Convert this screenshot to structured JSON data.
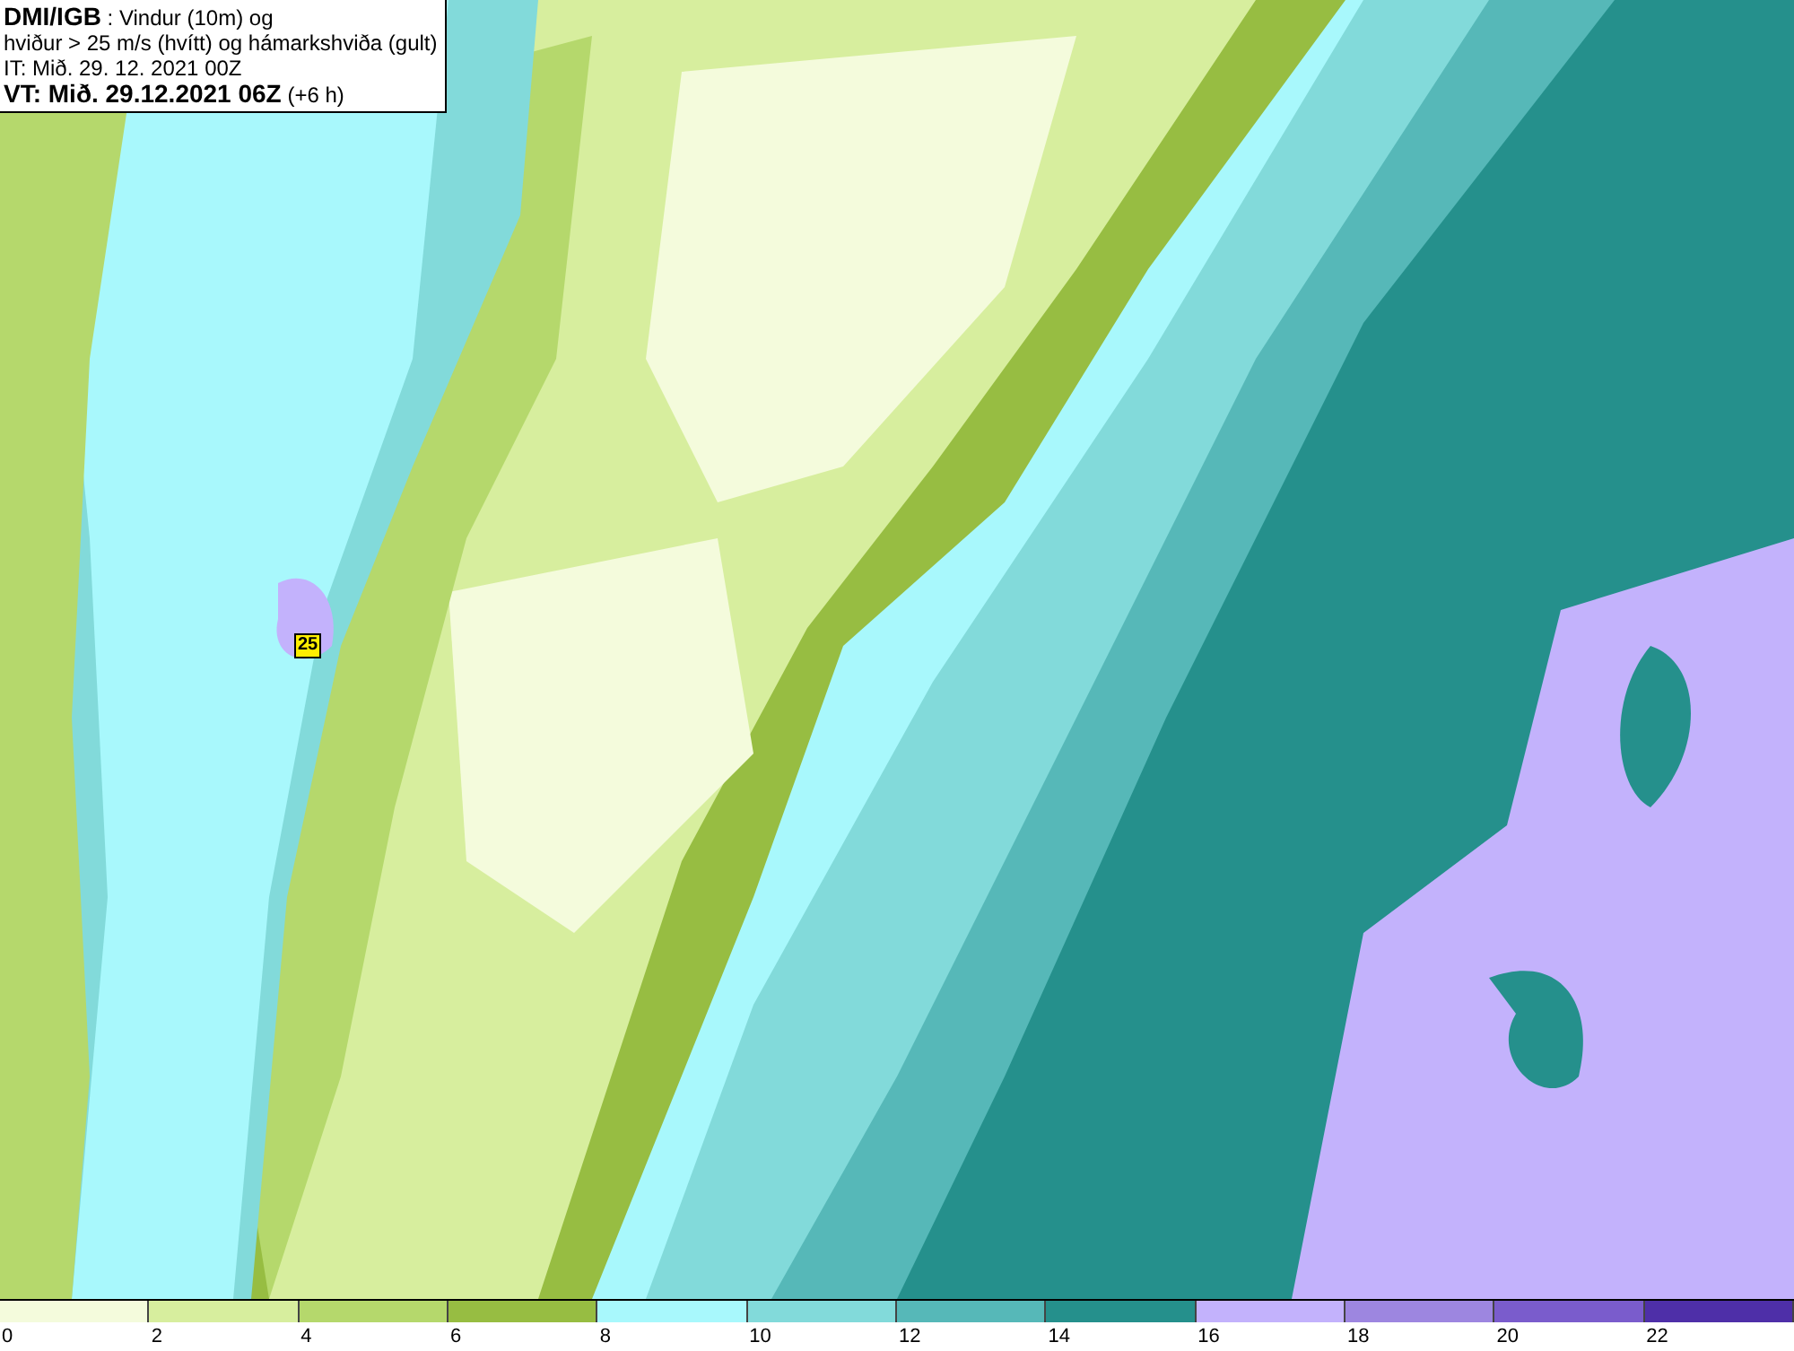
{
  "header": {
    "lines": [
      "**DMI/IGB** : Vindur (10m) og",
      "hviður > 25 m/s (hvítt) og hámarkshviða (gult)",
      "IT: Mið. 29. 12. 2021 00Z",
      "**VT: Mið. 29.12.2021 06Z** (+6 h)"
    ]
  },
  "map": {
    "markers": [
      {
        "label": "25"
      }
    ]
  },
  "legend": [
    {
      "color": "#f4fbdc",
      "label": "0"
    },
    {
      "color": "#d7ee9e",
      "label": "2"
    },
    {
      "color": "#b5d86c",
      "label": "4"
    },
    {
      "color": "#97bd42",
      "label": "6"
    },
    {
      "color": "#a8f8fc",
      "label": "8"
    },
    {
      "color": "#82dada",
      "label": "10"
    },
    {
      "color": "#56b8b8",
      "label": "12"
    },
    {
      "color": "#25908c",
      "label": "14"
    },
    {
      "color": "#c3b2fc",
      "label": "16"
    },
    {
      "color": "#9d86e0",
      "label": "18"
    },
    {
      "color": "#7a5ccc",
      "label": "20"
    },
    {
      "color": "#4e2fa8",
      "label": "22"
    }
  ]
}
